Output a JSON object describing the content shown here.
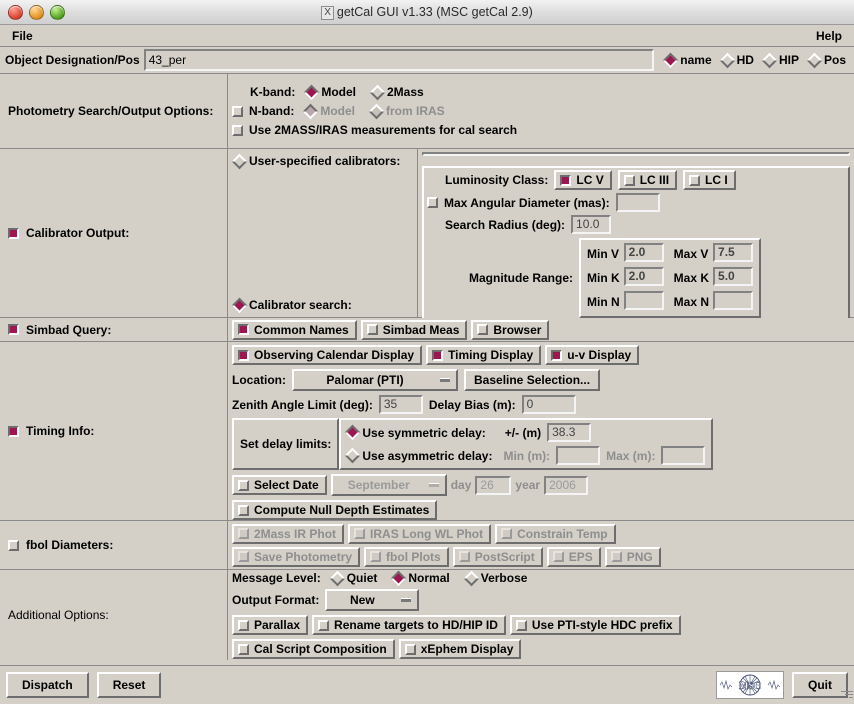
{
  "window": {
    "title": "getCal GUI v1.33 (MSC getCal 2.9)",
    "x_glyph": "X"
  },
  "menubar": {
    "file": "File",
    "help": "Help"
  },
  "object": {
    "label": "Object Designation/Pos",
    "value": "43_per",
    "id_types": [
      {
        "label": "name",
        "selected": true
      },
      {
        "label": "HD",
        "selected": false
      },
      {
        "label": "HIP",
        "selected": false
      },
      {
        "label": "Pos",
        "selected": false
      }
    ]
  },
  "photometry": {
    "section_label": "Photometry Search/Output Options:",
    "kband_label": "K-band:",
    "kband_options": [
      {
        "label": "Model",
        "selected": true
      },
      {
        "label": "2Mass",
        "selected": false
      }
    ],
    "nband_label": "N-band:",
    "nband_checked": false,
    "nband_options": [
      {
        "label": "Model",
        "selected": true
      },
      {
        "label": "from IRAS",
        "selected": false
      }
    ],
    "use_2mass_label": "Use 2MASS/IRAS measurements for cal search",
    "use_2mass_checked": false
  },
  "calibrator": {
    "section_label": "Calibrator Output:",
    "section_checked": true,
    "user_specified_label": "User-specified calibrators:",
    "user_specified_selected": false,
    "user_specified_value": "",
    "calibrator_search_label": "Calibrator search:",
    "calibrator_search_selected": true,
    "luminosity_label": "Luminosity Class:",
    "luminosity_classes": [
      {
        "label": "LC V",
        "checked": true
      },
      {
        "label": "LC III",
        "checked": false
      },
      {
        "label": "LC I",
        "checked": false
      }
    ],
    "max_angular_label": "Max Angular Diameter (mas):",
    "max_angular_checked": false,
    "max_angular_value": "",
    "search_radius_label": "Search Radius (deg):",
    "search_radius_value": "10.0",
    "magnitude_range_label": "Magnitude Range:",
    "magnitude_rows": [
      {
        "min_label": "Min V",
        "min_value": "2.0",
        "max_label": "Max V",
        "max_value": "7.5"
      },
      {
        "min_label": "Min K",
        "min_value": "2.0",
        "max_label": "Max K",
        "max_value": "5.0"
      },
      {
        "min_label": "Min N",
        "min_value": "",
        "max_label": "Max N",
        "max_value": ""
      }
    ]
  },
  "simbad": {
    "section_label": "Simbad Query:",
    "section_checked": true,
    "buttons": [
      {
        "label": "Common Names",
        "checked": true
      },
      {
        "label": "Simbad Meas",
        "checked": false
      },
      {
        "label": "Browser",
        "checked": false
      }
    ]
  },
  "timing": {
    "section_label": "Timing Info:",
    "section_checked": true,
    "displays": [
      {
        "label": "Observing Calendar Display",
        "checked": true
      },
      {
        "label": "Timing Display",
        "checked": true
      },
      {
        "label": "u-v Display",
        "checked": true
      }
    ],
    "location_label": "Location:",
    "location_value": "Palomar (PTI)",
    "baseline_button": "Baseline Selection...",
    "zenith_label": "Zenith Angle Limit (deg):",
    "zenith_value": "35",
    "delay_bias_label": "Delay Bias (m):",
    "delay_bias_value": "0",
    "set_delay_label": "Set delay limits:",
    "symmetric_label": "Use symmetric delay:",
    "symmetric_selected": true,
    "symmetric_pm_label": "+/- (m)",
    "symmetric_value": "38.3",
    "asymmetric_label": "Use asymmetric delay:",
    "asymmetric_selected": false,
    "asym_min_label": "Min (m):",
    "asym_min_value": "",
    "asym_max_label": "Max (m):",
    "asym_max_value": "",
    "select_date_label": "Select Date",
    "select_date_checked": false,
    "month_value": "September",
    "day_label": "day",
    "day_value": "26",
    "year_label": "year",
    "year_value": "2006",
    "compute_null_label": "Compute Null Depth Estimates",
    "compute_null_checked": false
  },
  "fbol": {
    "section_label": "fbol Diameters:",
    "section_checked": false,
    "row1": [
      {
        "label": "2Mass IR Phot",
        "checked": false
      },
      {
        "label": "IRAS Long WL Phot",
        "checked": false
      },
      {
        "label": "Constrain Temp",
        "checked": false
      }
    ],
    "row2": [
      {
        "label": "Save Photometry",
        "checked": false
      },
      {
        "label": "fbol Plots",
        "checked": false
      },
      {
        "label": "PostScript",
        "checked": false
      },
      {
        "label": "EPS",
        "checked": false
      },
      {
        "label": "PNG",
        "checked": false
      }
    ]
  },
  "additional": {
    "section_label": "Additional Options:",
    "message_level_label": "Message Level:",
    "message_levels": [
      {
        "label": "Quiet",
        "selected": false
      },
      {
        "label": "Normal",
        "selected": true
      },
      {
        "label": "Verbose",
        "selected": false
      }
    ],
    "output_format_label": "Output Format:",
    "output_format_value": "New",
    "row1": [
      {
        "label": "Parallax",
        "checked": false
      },
      {
        "label": "Rename targets to HD/HIP ID",
        "checked": false
      },
      {
        "label": "Use PTI-style HDC prefix",
        "checked": false
      }
    ],
    "row2": [
      {
        "label": "Cal Script Composition",
        "checked": false
      },
      {
        "label": "xEphem Display",
        "checked": false
      }
    ]
  },
  "bottom": {
    "dispatch": "Dispatch",
    "reset": "Reset",
    "quit": "Quit",
    "logo_text": "MSC"
  },
  "colors": {
    "accent": "#9c1750",
    "face": "#d4d0c8",
    "shadow": "#6d6d6d",
    "light": "#ffffff",
    "disabled_text": "#8e8e8e"
  }
}
